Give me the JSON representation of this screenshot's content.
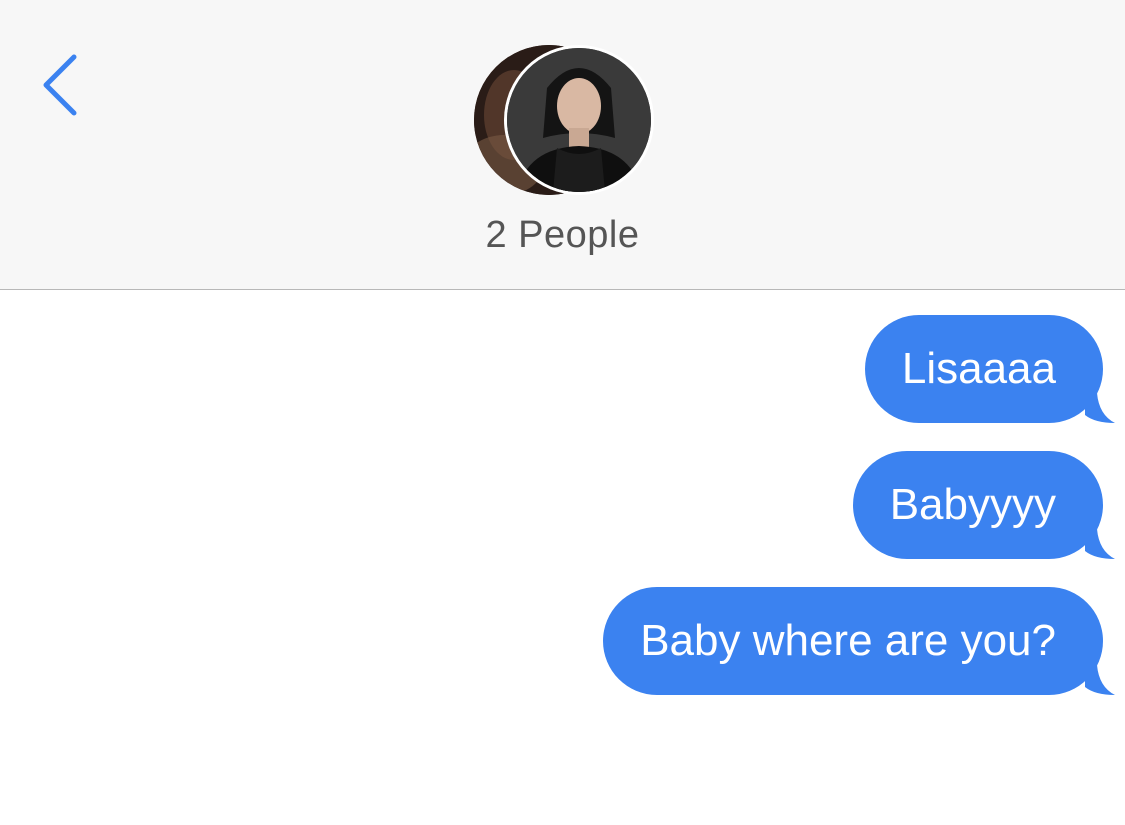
{
  "header": {
    "back_icon": "chevron-left-icon",
    "title": "2 People",
    "avatars": [
      "avatar-back",
      "avatar-front"
    ]
  },
  "colors": {
    "accent": "#3b82f0",
    "header_bg": "#f7f7f7",
    "title_text": "#555555",
    "bubble_text": "#ffffff"
  },
  "messages": [
    {
      "text": "Lisaaaa",
      "sender": "me"
    },
    {
      "text": "Babyyyy",
      "sender": "me"
    },
    {
      "text": "Baby where are you?",
      "sender": "me"
    }
  ]
}
